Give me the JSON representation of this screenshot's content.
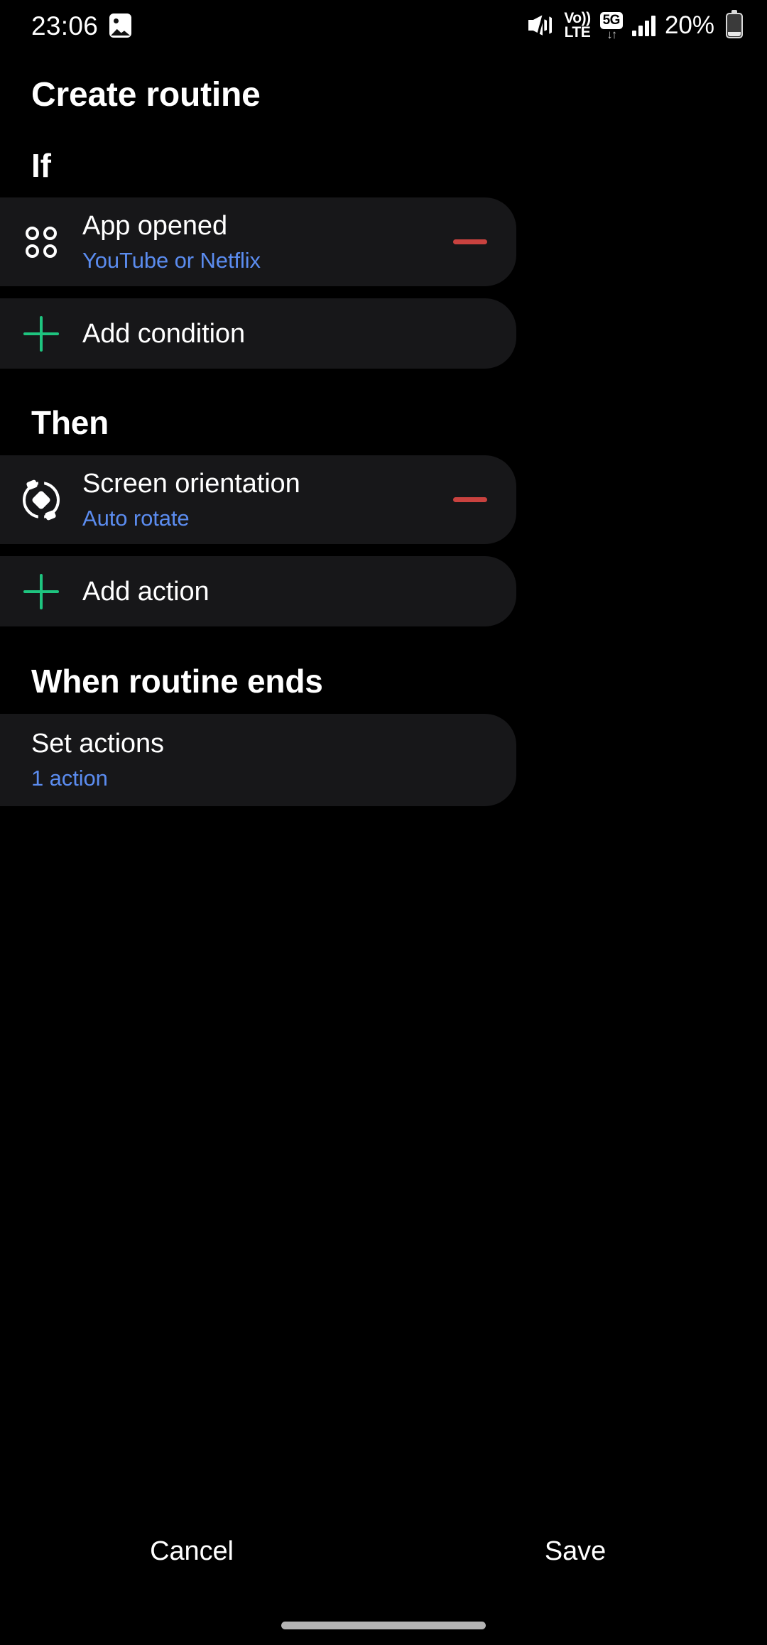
{
  "status_bar": {
    "time": "23:06",
    "gallery_icon": "gallery-icon",
    "mute_icon": "volume-mute-icon",
    "volte_top": "Vo))",
    "volte_bottom": "LTE",
    "network_badge": "5G",
    "network_arrows": "↓↑",
    "signal_icon": "signal-bars-icon",
    "battery_percent": "20%",
    "battery_icon": "battery-low-icon"
  },
  "page": {
    "title": "Create routine"
  },
  "sections": {
    "if": {
      "heading": "If",
      "condition": {
        "icon": "apps-grid-icon",
        "title": "App opened",
        "subtitle": "YouTube or Netflix",
        "remove_icon": "minus-icon"
      },
      "add": {
        "icon": "plus-icon",
        "label": "Add condition"
      }
    },
    "then": {
      "heading": "Then",
      "action": {
        "icon": "screen-rotate-icon",
        "title": "Screen orientation",
        "subtitle": "Auto rotate",
        "remove_icon": "minus-icon"
      },
      "add": {
        "icon": "plus-icon",
        "label": "Add action"
      }
    },
    "when_routine_ends": {
      "heading": "When routine ends",
      "item": {
        "title": "Set actions",
        "subtitle": "1 action"
      }
    }
  },
  "footer": {
    "cancel_label": "Cancel",
    "save_label": "Save"
  },
  "colors": {
    "background": "#000000",
    "card": "#171719",
    "link_blue": "#5b8cef",
    "add_green": "#1ec47f",
    "remove_red": "#c9423f",
    "text": "#ffffff"
  }
}
